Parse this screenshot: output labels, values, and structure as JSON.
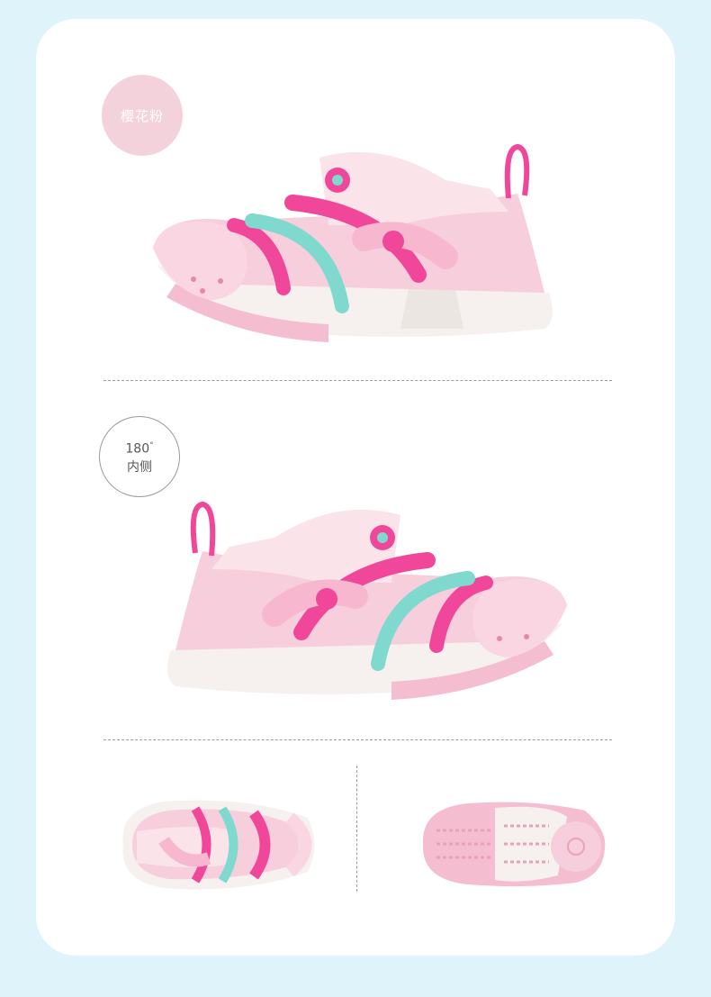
{
  "color_badge": {
    "label": "樱花粉"
  },
  "angle_badge": {
    "degrees": "180",
    "degree_mark": "°",
    "label": "内侧"
  },
  "colors": {
    "page_background": "#dff3fb",
    "card": "#ffffff",
    "badge_pink": "#f3d2dc",
    "shoe_pink_light": "#f7cfdc",
    "shoe_pink_hot": "#f0479a",
    "shoe_mint": "#7fd9cf",
    "sole_white": "#f6f1ee"
  },
  "icons": [
    "sandal-side-outer",
    "sandal-side-inner",
    "sandal-top-view",
    "sandal-sole-view"
  ]
}
